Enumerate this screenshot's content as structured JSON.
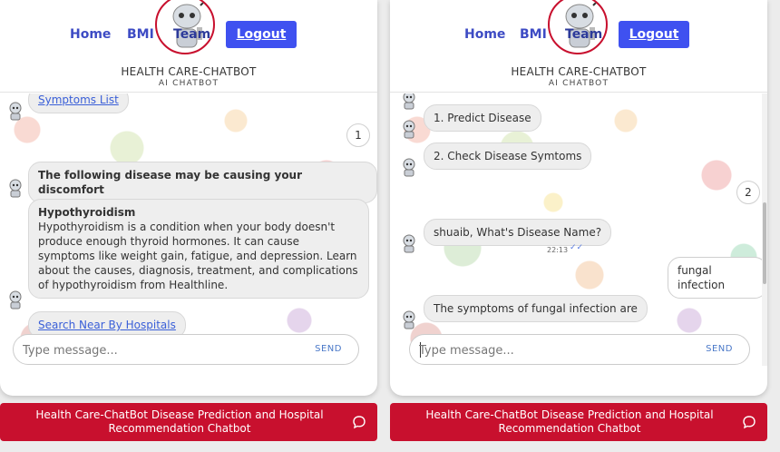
{
  "nav": {
    "home": "Home",
    "bmi": "BMI",
    "team": "Team",
    "logout": "Logout",
    "brand_title": "HEALTH CARE-CHATBOT",
    "brand_sub": "AI CHATBOT"
  },
  "left_chat": {
    "symptoms_link": "Symptoms List",
    "user_reply": "1",
    "disease_header": "The following disease may be causing your discomfort",
    "disease_name": "Hypothyroidism",
    "disease_desc": "Hypothyroidism is a condition when your body doesn't produce enough thyroid hormones. It can cause symptoms like weight gain, fatigue, and depression. Learn about the causes, diagnosis, treatment, and complications of hypothyroidism from Healthline.",
    "hospitals_link": "Search Near By Hospitals"
  },
  "right_chat": {
    "option1": "1. Predict Disease",
    "option2": "2. Check Disease Symtoms",
    "user_reply": "2",
    "bot_question": "shuaib, What's Disease Name?",
    "bot_time": "22:13",
    "user_disease": "fungal infection",
    "bot_symptoms": "The symptoms of fungal infection are"
  },
  "input": {
    "placeholder": "Type message...",
    "send": "SEND"
  },
  "footer": {
    "text": "Health Care-ChatBot Disease Prediction and Hospital Recommendation Chatbot"
  },
  "colors": {
    "accent": "#3f51f0",
    "brand_red": "#c8102e",
    "nav_text": "#3d4bc4"
  }
}
